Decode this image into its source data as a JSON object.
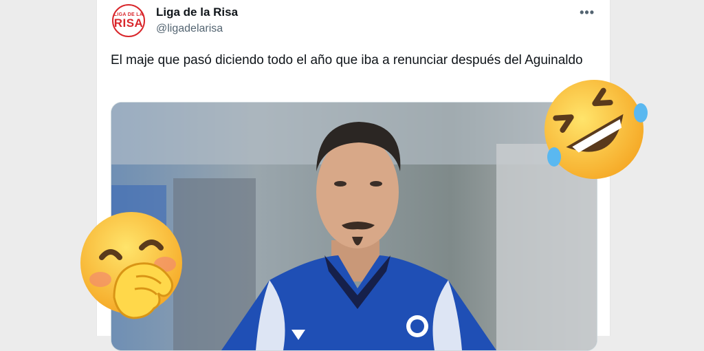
{
  "tweet": {
    "display_name": "Liga de la Risa",
    "handle": "@ligadelarisa",
    "avatar_text_top": "LIGA DE LA",
    "avatar_text_big": "RISA",
    "text": "El maje que pasó diciendo todo el año que iba a renunciar después del Aguinaldo",
    "more_icon": "more-dots-icon"
  },
  "emojis": [
    "rofl-emoji",
    "face-with-hand-over-mouth-emoji"
  ],
  "colors": {
    "brand": "#d9262b",
    "jersey": "#1f4fb5",
    "background": "#ececec"
  }
}
